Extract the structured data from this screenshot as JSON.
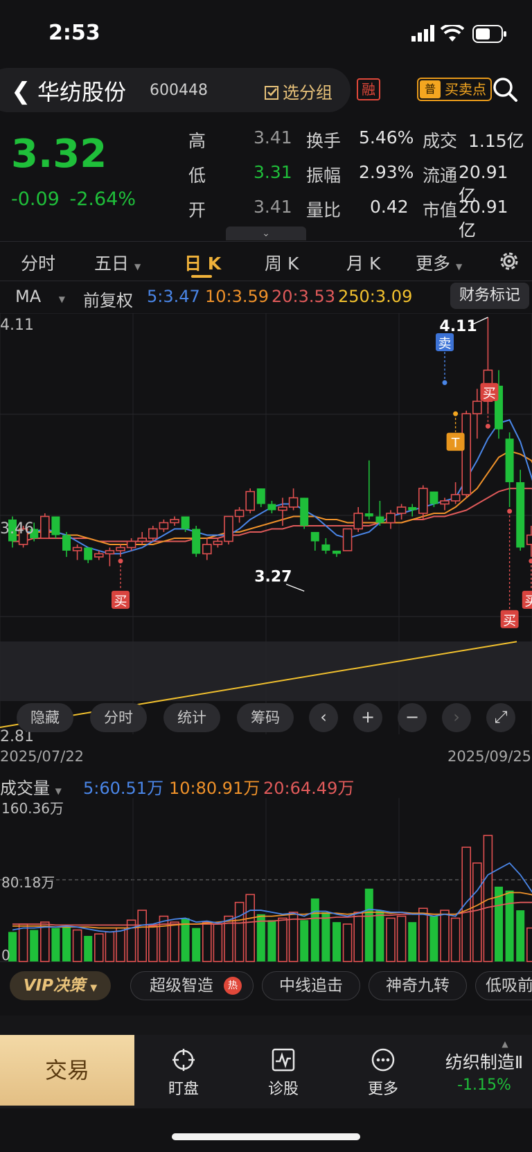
{
  "status": {
    "time": "2:53"
  },
  "header": {
    "name": "华纺股份",
    "code": "600448",
    "select_group": "选分组",
    "rong": "融",
    "buysell_prefix": "普",
    "buysell": "买卖点"
  },
  "quote": {
    "price": "3.32",
    "change": "-0.09",
    "change_pct": "-2.64%",
    "rows": [
      {
        "l1": "高",
        "v1": "3.41",
        "l2": "换手",
        "v2": "5.46%",
        "l3": "成交",
        "v3": "1.15亿"
      },
      {
        "l1": "低",
        "v1": "3.31",
        "l2": "振幅",
        "v2": "2.93%",
        "l3": "流通",
        "v3": "20.91亿"
      },
      {
        "l1": "开",
        "v1": "3.41",
        "l2": "量比",
        "v2": "0.42",
        "l3": "市值",
        "v3": "20.91亿"
      }
    ]
  },
  "tabs": [
    "分时",
    "五日",
    "日 K",
    "周 K",
    "月 K",
    "更多"
  ],
  "active_tab": "日 K",
  "ma": {
    "label": "MA",
    "adj": "前复权",
    "ma5": "5:3.47",
    "ma10": "10:3.59",
    "ma20": "20:3.53",
    "ma250": "250:3.09",
    "finance": "财务标记"
  },
  "colors": {
    "up": "#e05050",
    "down": "#1fbf3a",
    "ma5": "#4a86e8",
    "ma10": "#f0922a",
    "ma20": "#e05a5a",
    "ma250": "#f2c12e",
    "accent": "#f0b23a"
  },
  "kline": {
    "y_top_label": "4.11",
    "y_mid_label": "3.46",
    "y_bottom_label": "2.81",
    "ylim": [
      2.81,
      4.11
    ],
    "date_start": "2025/07/22",
    "date_end": "2025/09/25",
    "max_label": "4.11",
    "min_label": "3.27",
    "sell": "卖",
    "buy": "买",
    "t": "T",
    "candles": [
      {
        "o": 3.46,
        "h": 3.47,
        "l": 3.37,
        "c": 3.39
      },
      {
        "o": 3.38,
        "h": 3.44,
        "l": 3.37,
        "c": 3.43
      },
      {
        "o": 3.43,
        "h": 3.45,
        "l": 3.39,
        "c": 3.4
      },
      {
        "o": 3.4,
        "h": 3.48,
        "l": 3.4,
        "c": 3.47
      },
      {
        "o": 3.47,
        "h": 3.47,
        "l": 3.4,
        "c": 3.41
      },
      {
        "o": 3.41,
        "h": 3.42,
        "l": 3.34,
        "c": 3.36
      },
      {
        "o": 3.36,
        "h": 3.38,
        "l": 3.33,
        "c": 3.37
      },
      {
        "o": 3.37,
        "h": 3.37,
        "l": 3.32,
        "c": 3.33
      },
      {
        "o": 3.34,
        "h": 3.36,
        "l": 3.33,
        "c": 3.35
      },
      {
        "o": 3.35,
        "h": 3.37,
        "l": 3.31,
        "c": 3.36
      },
      {
        "o": 3.36,
        "h": 3.38,
        "l": 3.34,
        "c": 3.37
      },
      {
        "o": 3.37,
        "h": 3.4,
        "l": 3.36,
        "c": 3.39
      },
      {
        "o": 3.39,
        "h": 3.42,
        "l": 3.38,
        "c": 3.4
      },
      {
        "o": 3.4,
        "h": 3.44,
        "l": 3.39,
        "c": 3.43
      },
      {
        "o": 3.43,
        "h": 3.46,
        "l": 3.42,
        "c": 3.45
      },
      {
        "o": 3.45,
        "h": 3.47,
        "l": 3.44,
        "c": 3.46
      },
      {
        "o": 3.47,
        "h": 3.47,
        "l": 3.42,
        "c": 3.43
      },
      {
        "o": 3.43,
        "h": 3.44,
        "l": 3.34,
        "c": 3.35
      },
      {
        "o": 3.35,
        "h": 3.4,
        "l": 3.33,
        "c": 3.38
      },
      {
        "o": 3.38,
        "h": 3.4,
        "l": 3.37,
        "c": 3.39
      },
      {
        "o": 3.39,
        "h": 3.47,
        "l": 3.38,
        "c": 3.47
      },
      {
        "o": 3.47,
        "h": 3.5,
        "l": 3.45,
        "c": 3.49
      },
      {
        "o": 3.49,
        "h": 3.56,
        "l": 3.48,
        "c": 3.55
      },
      {
        "o": 3.56,
        "h": 3.56,
        "l": 3.5,
        "c": 3.51
      },
      {
        "o": 3.51,
        "h": 3.52,
        "l": 3.48,
        "c": 3.49
      },
      {
        "o": 3.49,
        "h": 3.53,
        "l": 3.44,
        "c": 3.5
      },
      {
        "o": 3.5,
        "h": 3.56,
        "l": 3.49,
        "c": 3.53
      },
      {
        "o": 3.53,
        "h": 3.53,
        "l": 3.43,
        "c": 3.44
      },
      {
        "o": 3.42,
        "h": 3.42,
        "l": 3.36,
        "c": 3.39
      },
      {
        "o": 3.38,
        "h": 3.4,
        "l": 3.35,
        "c": 3.36
      },
      {
        "o": 3.36,
        "h": 3.36,
        "l": 3.34,
        "c": 3.35
      },
      {
        "o": 3.36,
        "h": 3.43,
        "l": 3.36,
        "c": 3.43
      },
      {
        "o": 3.43,
        "h": 3.5,
        "l": 3.42,
        "c": 3.48
      },
      {
        "o": 3.48,
        "h": 3.65,
        "l": 3.46,
        "c": 3.47
      },
      {
        "o": 3.47,
        "h": 3.52,
        "l": 3.44,
        "c": 3.45
      },
      {
        "o": 3.45,
        "h": 3.49,
        "l": 3.43,
        "c": 3.48
      },
      {
        "o": 3.48,
        "h": 3.51,
        "l": 3.46,
        "c": 3.5
      },
      {
        "o": 3.5,
        "h": 3.51,
        "l": 3.47,
        "c": 3.49
      },
      {
        "o": 3.48,
        "h": 3.57,
        "l": 3.46,
        "c": 3.56
      },
      {
        "o": 3.55,
        "h": 3.55,
        "l": 3.5,
        "c": 3.51
      },
      {
        "o": 3.51,
        "h": 3.53,
        "l": 3.49,
        "c": 3.52
      },
      {
        "o": 3.52,
        "h": 3.58,
        "l": 3.51,
        "c": 3.54
      },
      {
        "o": 3.54,
        "h": 3.81,
        "l": 3.53,
        "c": 3.8
      },
      {
        "o": 3.8,
        "h": 3.88,
        "l": 3.72,
        "c": 3.84
      },
      {
        "o": 3.84,
        "h": 4.11,
        "l": 3.8,
        "c": 3.94
      },
      {
        "o": 3.89,
        "h": 3.94,
        "l": 3.72,
        "c": 3.75
      },
      {
        "o": 3.72,
        "h": 3.74,
        "l": 3.5,
        "c": 3.58
      },
      {
        "o": 3.58,
        "h": 3.62,
        "l": 3.36,
        "c": 3.37
      },
      {
        "o": 3.38,
        "h": 3.44,
        "l": 3.34,
        "c": 3.41
      },
      {
        "o": 3.41,
        "h": 3.42,
        "l": 3.33,
        "c": 3.34
      }
    ],
    "ma5": [
      3.43,
      3.42,
      3.42,
      3.43,
      3.42,
      3.41,
      3.39,
      3.37,
      3.36,
      3.35,
      3.35,
      3.36,
      3.37,
      3.39,
      3.41,
      3.43,
      3.43,
      3.42,
      3.41,
      3.41,
      3.41,
      3.43,
      3.46,
      3.48,
      3.5,
      3.51,
      3.51,
      3.49,
      3.47,
      3.44,
      3.41,
      3.4,
      3.41,
      3.42,
      3.45,
      3.47,
      3.48,
      3.49,
      3.5,
      3.51,
      3.52,
      3.53,
      3.59,
      3.65,
      3.72,
      3.77,
      3.78,
      3.71,
      3.6,
      3.49
    ],
    "ma10": [
      3.41,
      3.41,
      3.42,
      3.42,
      3.42,
      3.41,
      3.41,
      3.4,
      3.39,
      3.38,
      3.38,
      3.38,
      3.38,
      3.38,
      3.39,
      3.4,
      3.4,
      3.4,
      3.4,
      3.41,
      3.42,
      3.42,
      3.43,
      3.44,
      3.45,
      3.46,
      3.47,
      3.47,
      3.47,
      3.46,
      3.46,
      3.45,
      3.45,
      3.45,
      3.45,
      3.45,
      3.45,
      3.46,
      3.47,
      3.48,
      3.48,
      3.5,
      3.53,
      3.56,
      3.61,
      3.66,
      3.68,
      3.67,
      3.65,
      3.59
    ],
    "ma20": [
      3.39,
      3.39,
      3.4,
      3.4,
      3.4,
      3.4,
      3.4,
      3.4,
      3.39,
      3.39,
      3.39,
      3.39,
      3.39,
      3.39,
      3.39,
      3.39,
      3.39,
      3.4,
      3.4,
      3.4,
      3.41,
      3.41,
      3.42,
      3.42,
      3.43,
      3.43,
      3.44,
      3.44,
      3.44,
      3.44,
      3.44,
      3.44,
      3.44,
      3.44,
      3.45,
      3.45,
      3.45,
      3.46,
      3.46,
      3.47,
      3.47,
      3.48,
      3.49,
      3.51,
      3.53,
      3.55,
      3.56,
      3.56,
      3.56,
      3.55
    ],
    "ma250": [
      2.81,
      3.09
    ],
    "buy_signals": [
      10,
      46,
      48
    ],
    "sell_signals": [
      40,
      49
    ]
  },
  "controls": {
    "hide": "隐藏",
    "fenshi": "分时",
    "stats": "统计",
    "chips": "筹码"
  },
  "volume": {
    "label": "成交量",
    "ma5": "5:60.51万",
    "ma10": "10:80.91万",
    "ma20": "20:64.49万",
    "top_label": "160.36万",
    "mid_label": "80.18万",
    "zero_label": "0",
    "values": [
      30,
      38,
      32,
      40,
      34,
      36,
      32,
      26,
      28,
      30,
      34,
      42,
      52,
      36,
      46,
      40,
      44,
      34,
      40,
      38,
      46,
      60,
      68,
      48,
      42,
      44,
      50,
      42,
      64,
      50,
      40,
      38,
      50,
      74,
      52,
      44,
      46,
      40,
      54,
      46,
      52,
      44,
      116,
      100,
      128,
      76,
      72,
      52,
      34,
      40
    ],
    "ma5v": [
      32,
      34,
      34,
      35,
      35,
      36,
      35,
      33,
      31,
      30,
      31,
      34,
      37,
      38,
      41,
      43,
      44,
      40,
      41,
      39,
      42,
      46,
      52,
      52,
      50,
      48,
      49,
      46,
      51,
      51,
      48,
      46,
      49,
      53,
      52,
      50,
      50,
      48,
      48,
      46,
      48,
      46,
      60,
      72,
      88,
      94,
      100,
      88,
      72,
      56
    ],
    "ma10v": [
      36,
      36,
      36,
      36,
      35,
      35,
      35,
      35,
      34,
      34,
      34,
      34,
      35,
      35,
      36,
      37,
      38,
      38,
      39,
      40,
      41,
      42,
      44,
      46,
      46,
      47,
      48,
      48,
      49,
      49,
      49,
      48,
      49,
      50,
      50,
      49,
      50,
      49,
      49,
      48,
      48,
      48,
      52,
      57,
      63,
      66,
      70,
      70,
      68,
      64
    ],
    "ma20v": [
      38,
      38,
      38,
      38,
      37,
      37,
      37,
      37,
      37,
      37,
      37,
      37,
      37,
      37,
      38,
      38,
      38,
      38,
      38,
      38,
      39,
      39,
      40,
      41,
      41,
      42,
      43,
      43,
      44,
      44,
      45,
      45,
      46,
      46,
      47,
      47,
      48,
      48,
      48,
      48,
      48,
      48,
      50,
      52,
      55,
      57,
      59,
      60,
      60,
      60
    ]
  },
  "strategies": {
    "vip": "VIP决策",
    "items": [
      "超级智造",
      "中线追击",
      "神奇九转",
      "低吸前"
    ],
    "hot": "热"
  },
  "bottom_nav": {
    "trade": "交易",
    "watch": "盯盘",
    "diagnose": "诊股",
    "more": "更多",
    "sector": "纺织制造Ⅱ",
    "sector_pct": "-1.15%"
  }
}
